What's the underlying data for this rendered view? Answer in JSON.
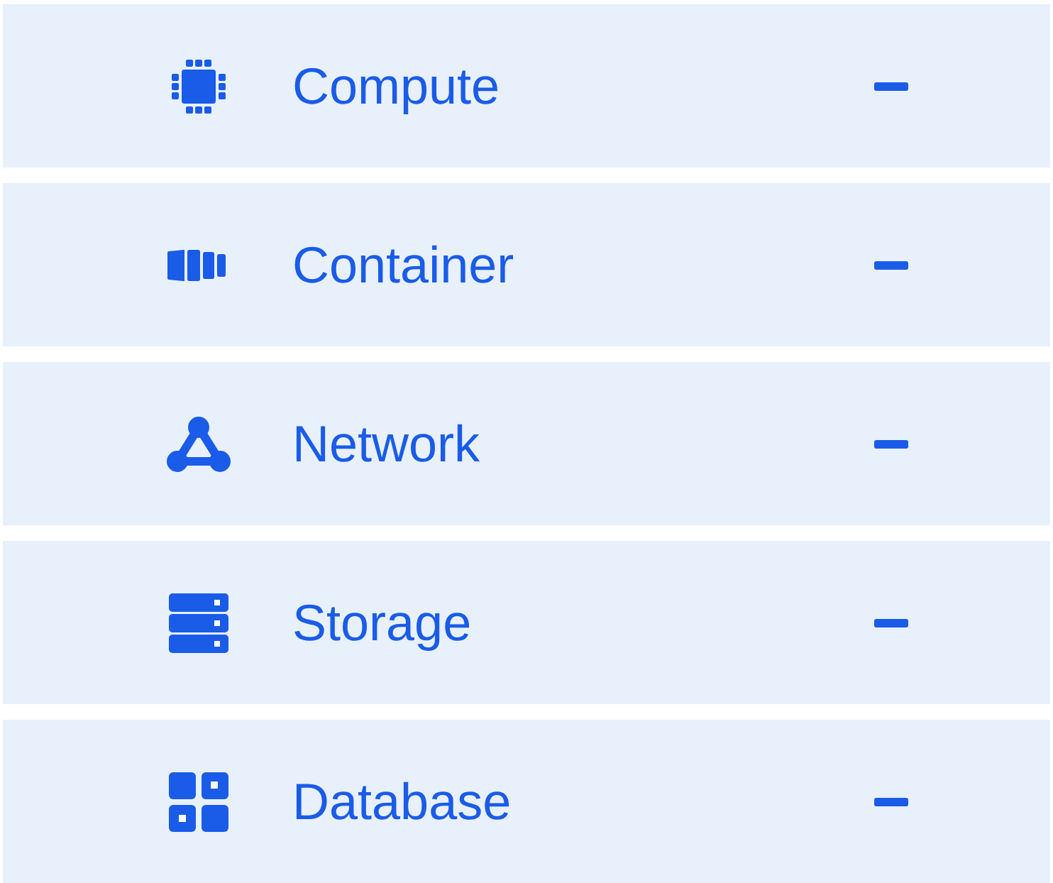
{
  "sections": [
    {
      "label": "Compute",
      "expanded": true
    },
    {
      "label": "Container",
      "expanded": true
    },
    {
      "label": "Network",
      "expanded": true
    },
    {
      "label": "Storage",
      "expanded": true
    },
    {
      "label": "Database",
      "expanded": true
    }
  ]
}
